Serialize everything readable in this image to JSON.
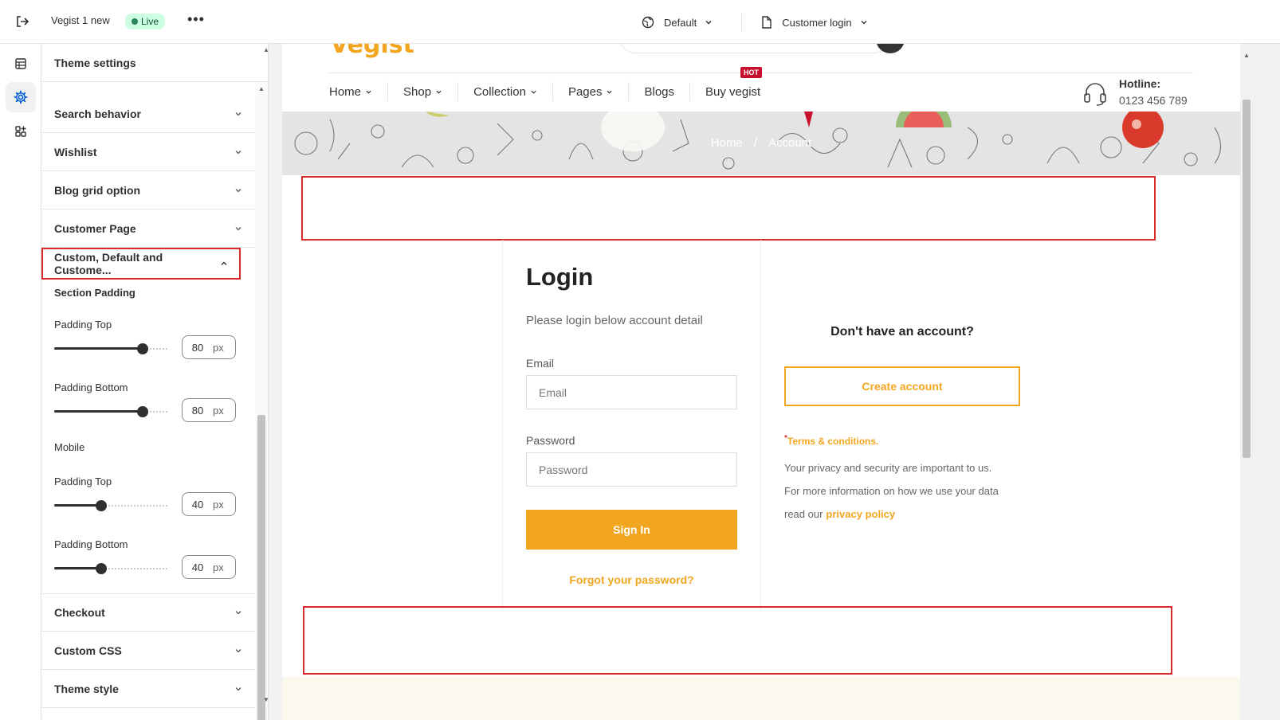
{
  "topbar": {
    "store_name": "Vegist 1 new",
    "live_label": "Live",
    "more_label": "•••",
    "theme_selector": "Default",
    "page_selector": "Customer login"
  },
  "panel": {
    "title": "Theme settings",
    "sections": [
      {
        "label": "Search behavior"
      },
      {
        "label": "Wishlist"
      },
      {
        "label": "Blog grid option"
      },
      {
        "label": "Customer Page"
      },
      {
        "label": "Custom, Default and Custome..."
      },
      {
        "label": "Checkout"
      },
      {
        "label": "Custom CSS"
      },
      {
        "label": "Theme style"
      }
    ],
    "section_padding_label": "Section Padding",
    "desktop": {
      "padding_top_label": "Padding Top",
      "padding_top_value": "80",
      "padding_top_level": 0.8,
      "padding_bottom_label": "Padding Bottom",
      "padding_bottom_value": "80",
      "padding_bottom_level": 0.8
    },
    "mobile_label": "Mobile",
    "mobile": {
      "padding_top_label": "Padding Top",
      "padding_top_value": "40",
      "padding_top_level": 0.4,
      "padding_bottom_label": "Padding Bottom",
      "padding_bottom_value": "40",
      "padding_bottom_level": 0.4
    },
    "unit": "px"
  },
  "preview": {
    "logo": "Vegist",
    "nav": [
      {
        "label": "Home",
        "has_caret": true
      },
      {
        "label": "Shop",
        "has_caret": true
      },
      {
        "label": "Collection",
        "has_caret": true
      },
      {
        "label": "Pages",
        "has_caret": true
      },
      {
        "label": "Blogs",
        "has_caret": false
      },
      {
        "label": "Buy vegist",
        "has_caret": false
      }
    ],
    "hot_badge": "HOT",
    "hotline_label": "Hotline:",
    "hotline_number": "0123 456 789",
    "breadcrumb": {
      "home": "Home",
      "separator": "/",
      "current": "Account"
    },
    "login": {
      "title": "Login",
      "subtitle": "Please login below account detail",
      "email_label": "Email",
      "email_placeholder": "Email",
      "password_label": "Password",
      "password_placeholder": "Password",
      "signin": "Sign In",
      "forgot": "Forgot your password?"
    },
    "register": {
      "heading": "Don't have an account?",
      "create": "Create account",
      "terms_mark": "*",
      "terms": "Terms & conditions.",
      "line1": "Your privacy and security are important to us.",
      "line2": "For more information on how we use your data",
      "line3": "read our",
      "privacy_link": "privacy policy"
    }
  },
  "colors": {
    "accent": "#f2a61f",
    "highlight_border": "#d82c2c",
    "live_badge_bg": "#cdfee1"
  }
}
